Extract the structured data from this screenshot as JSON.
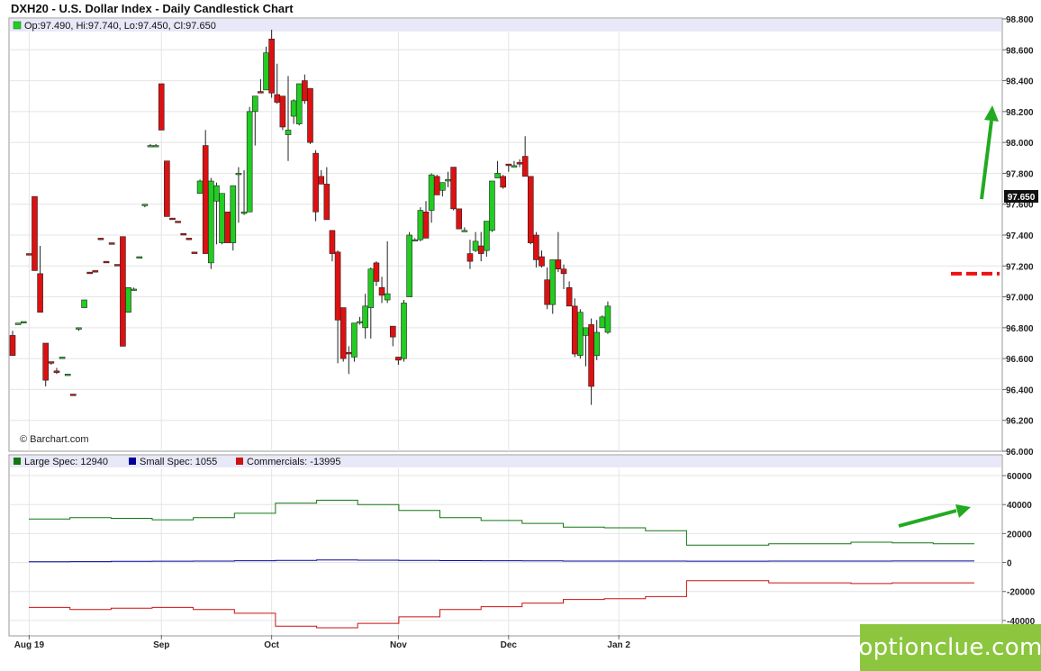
{
  "title": "DXH20 - U.S. Dollar Index - Daily Candlestick Chart",
  "ohlc_legend": "Op:97.490, Hi:97.740, Lo:97.450, Cl:97.650",
  "last_price_label": "97.650",
  "watermark_source": "© Barchart.com",
  "site_logo": "optionclue.com",
  "colors": {
    "up": "#22cc22",
    "down": "#dd1111",
    "large_spec": "#117711",
    "small_spec": "#000099",
    "commercials": "#cc1111",
    "annotation_green": "#22aa22",
    "annotation_red": "#ee1111",
    "legend_bar": "#e8e8f8"
  },
  "chart_data": [
    {
      "type": "candlestick",
      "title": "DXH20 - U.S. Dollar Index - Daily Candlestick Chart",
      "ylim": [
        96.0,
        98.8
      ],
      "yticks": [
        "98.800",
        "98.600",
        "98.400",
        "98.200",
        "98.000",
        "97.800",
        "97.600",
        "97.400",
        "97.200",
        "97.000",
        "96.800",
        "96.600",
        "96.400",
        "96.200",
        "96.000"
      ],
      "x_labels": [
        "Aug 19",
        "Sep",
        "Oct",
        "Nov",
        "Dec",
        "Jan 2"
      ],
      "x_label_index": [
        3,
        27,
        47,
        70,
        90,
        110
      ],
      "annotations": [
        "green-arrow-up",
        "red-dashed-level 97.15"
      ],
      "candles": [
        [
          96.75,
          96.78,
          96.62,
          96.62
        ],
        [
          96.82,
          96.83,
          96.82,
          96.83
        ],
        [
          96.83,
          96.84,
          96.83,
          96.84
        ],
        [
          97.28,
          97.28,
          97.27,
          97.27
        ],
        [
          97.65,
          97.65,
          97.17,
          97.17
        ],
        [
          97.15,
          97.33,
          96.9,
          96.9
        ],
        [
          96.7,
          96.7,
          96.42,
          96.46
        ],
        [
          96.58,
          96.58,
          96.56,
          96.57
        ],
        [
          96.52,
          96.54,
          96.5,
          96.51
        ],
        [
          96.6,
          96.61,
          96.6,
          96.61
        ],
        [
          96.49,
          96.5,
          96.49,
          96.5
        ],
        [
          96.37,
          96.37,
          96.36,
          96.36
        ],
        [
          96.79,
          96.8,
          96.78,
          96.8
        ],
        [
          96.93,
          96.98,
          96.93,
          96.98
        ],
        [
          97.16,
          97.16,
          97.15,
          97.15
        ],
        [
          97.17,
          97.17,
          97.16,
          97.16
        ],
        [
          97.38,
          97.38,
          97.37,
          97.37
        ],
        [
          97.23,
          97.23,
          97.22,
          97.22
        ],
        [
          97.35,
          97.35,
          97.34,
          97.34
        ],
        [
          97.21,
          97.21,
          97.2,
          97.2
        ],
        [
          97.39,
          97.39,
          96.68,
          96.68
        ],
        [
          96.9,
          97.05,
          96.9,
          97.06
        ],
        [
          97.05,
          97.06,
          97.04,
          97.05
        ],
        [
          97.25,
          97.26,
          97.25,
          97.26
        ],
        [
          97.59,
          97.6,
          97.58,
          97.6
        ],
        [
          97.98,
          97.99,
          97.97,
          97.98
        ],
        [
          97.98,
          97.99,
          97.97,
          97.98
        ],
        [
          98.38,
          98.38,
          98.08,
          98.08
        ],
        [
          97.88,
          97.88,
          97.52,
          97.52
        ],
        [
          97.51,
          97.51,
          97.5,
          97.5
        ],
        [
          97.49,
          97.49,
          97.48,
          97.48
        ],
        [
          97.41,
          97.41,
          97.4,
          97.4
        ],
        [
          97.38,
          97.38,
          97.37,
          97.37
        ],
        [
          97.29,
          97.29,
          97.28,
          97.28
        ],
        [
          97.67,
          97.76,
          97.67,
          97.75
        ],
        [
          97.98,
          98.08,
          97.28,
          97.28
        ],
        [
          97.22,
          97.77,
          97.18,
          97.75
        ],
        [
          97.62,
          97.74,
          97.34,
          97.72
        ],
        [
          97.35,
          97.67,
          97.34,
          97.67
        ],
        [
          97.55,
          97.55,
          97.35,
          97.35
        ],
        [
          97.35,
          97.72,
          97.3,
          97.72
        ],
        [
          97.8,
          97.84,
          97.48,
          97.8
        ],
        [
          97.54,
          97.82,
          97.53,
          97.55
        ],
        [
          97.55,
          98.23,
          97.55,
          98.2
        ],
        [
          98.2,
          98.3,
          97.98,
          98.3
        ],
        [
          98.33,
          98.41,
          98.32,
          98.32
        ],
        [
          98.34,
          98.62,
          98.34,
          98.58
        ],
        [
          98.67,
          98.73,
          98.29,
          98.32
        ],
        [
          98.31,
          98.51,
          98.25,
          98.26
        ],
        [
          98.3,
          98.3,
          98.08,
          98.1
        ],
        [
          98.05,
          98.43,
          97.88,
          98.08
        ],
        [
          98.17,
          98.28,
          98.12,
          98.27
        ],
        [
          98.12,
          98.37,
          98.11,
          98.38
        ],
        [
          98.4,
          98.44,
          98.25,
          98.27
        ],
        [
          98.35,
          98.35,
          97.99,
          98.0
        ],
        [
          97.93,
          97.95,
          97.49,
          97.55
        ],
        [
          97.78,
          97.82,
          97.73,
          97.73
        ],
        [
          97.73,
          97.84,
          97.5,
          97.5
        ],
        [
          97.43,
          97.43,
          97.23,
          97.28
        ],
        [
          97.29,
          97.3,
          96.57,
          96.85
        ],
        [
          96.93,
          96.93,
          96.58,
          96.6
        ],
        [
          96.64,
          96.68,
          96.5,
          96.63
        ],
        [
          96.61,
          96.79,
          96.58,
          96.83
        ],
        [
          96.84,
          96.87,
          96.82,
          96.84
        ],
        [
          96.8,
          97.02,
          96.73,
          96.94
        ],
        [
          96.93,
          97.19,
          96.73,
          97.18
        ],
        [
          97.22,
          97.23,
          97.07,
          97.1
        ],
        [
          97.06,
          97.13,
          96.96,
          97.01
        ],
        [
          96.98,
          97.36,
          96.96,
          97.02
        ],
        [
          96.81,
          96.81,
          96.68,
          96.74
        ],
        [
          96.61,
          96.61,
          96.56,
          96.59
        ],
        [
          96.6,
          96.98,
          96.58,
          96.96
        ],
        [
          97.0,
          97.42,
          97.0,
          97.4
        ],
        [
          97.37,
          97.38,
          97.36,
          97.37
        ],
        [
          97.37,
          97.58,
          97.36,
          97.56
        ],
        [
          97.55,
          97.62,
          97.38,
          97.38
        ],
        [
          97.56,
          97.8,
          97.48,
          97.79
        ],
        [
          97.78,
          97.79,
          97.66,
          97.66
        ],
        [
          97.69,
          97.73,
          97.65,
          97.74
        ],
        [
          97.75,
          97.81,
          97.71,
          97.76
        ],
        [
          97.84,
          97.84,
          97.56,
          97.57
        ],
        [
          97.57,
          97.57,
          97.45,
          97.44
        ],
        [
          97.43,
          97.45,
          97.42,
          97.43
        ],
        [
          97.28,
          97.37,
          97.18,
          97.23
        ],
        [
          97.3,
          97.42,
          97.29,
          97.36
        ],
        [
          97.33,
          97.42,
          97.23,
          97.28
        ],
        [
          97.3,
          97.49,
          97.26,
          97.49
        ],
        [
          97.43,
          97.75,
          97.42,
          97.75
        ],
        [
          97.77,
          97.88,
          97.77,
          97.8
        ],
        [
          97.78,
          97.79,
          97.7,
          97.71
        ],
        [
          97.86,
          97.86,
          97.81,
          97.85
        ],
        [
          97.84,
          97.88,
          97.84,
          97.85
        ],
        [
          97.87,
          97.89,
          97.84,
          97.86
        ],
        [
          97.91,
          98.04,
          97.79,
          97.78
        ],
        [
          97.78,
          97.78,
          97.34,
          97.35
        ],
        [
          97.4,
          97.42,
          97.19,
          97.24
        ],
        [
          97.26,
          97.3,
          97.19,
          97.2
        ],
        [
          97.11,
          97.19,
          96.92,
          96.95
        ],
        [
          96.95,
          97.23,
          96.89,
          97.24
        ],
        [
          97.24,
          97.42,
          97.16,
          97.18
        ],
        [
          97.18,
          97.21,
          97.05,
          97.15
        ],
        [
          97.06,
          97.1,
          96.95,
          96.94
        ],
        [
          96.94,
          96.99,
          96.61,
          96.63
        ],
        [
          96.62,
          96.92,
          96.6,
          96.9
        ],
        [
          96.75,
          96.8,
          96.55,
          96.8
        ],
        [
          96.82,
          96.86,
          96.3,
          96.42
        ],
        [
          96.62,
          96.85,
          96.59,
          96.77
        ],
        [
          96.8,
          96.88,
          96.8,
          96.87
        ],
        [
          96.77,
          96.97,
          96.76,
          96.94
        ]
      ]
    },
    {
      "type": "line",
      "title": "COT positions",
      "ylim": [
        -50000,
        65000
      ],
      "yticks": [
        "60000",
        "40000",
        "20000",
        "0",
        "-20000",
        "-40000"
      ],
      "x_labels": [
        "Aug 19",
        "Sep",
        "Oct",
        "Nov",
        "Dec",
        "Jan 2"
      ],
      "series": [
        {
          "name": "Large Spec",
          "legend_label": "Large Spec: 12940",
          "values": [
            30000,
            31000,
            30500,
            29500,
            31000,
            34000,
            41000,
            43000,
            40000,
            36000,
            31000,
            29000,
            27000,
            24500,
            24000,
            22000,
            12000,
            12000,
            13000,
            13000,
            14000,
            13500,
            12940
          ]
        },
        {
          "name": "Small Spec",
          "legend_label": "Small Spec: 1055",
          "values": [
            500,
            600,
            800,
            900,
            1000,
            1200,
            1500,
            1700,
            1600,
            1500,
            1300,
            1200,
            1100,
            1000,
            1000,
            1000,
            900,
            900,
            1000,
            1000,
            1000,
            1050,
            1055
          ]
        },
        {
          "name": "Commercials",
          "legend_label": "Commercials: -13995",
          "values": [
            -31000,
            -32500,
            -31500,
            -31000,
            -32500,
            -35000,
            -44000,
            -45000,
            -42000,
            -37500,
            -32500,
            -30500,
            -28000,
            -25500,
            -25000,
            -23500,
            -12500,
            -12500,
            -14000,
            -14000,
            -14500,
            -14000,
            -13995
          ]
        }
      ],
      "annotations": [
        "green-arrow-up-right"
      ]
    }
  ]
}
